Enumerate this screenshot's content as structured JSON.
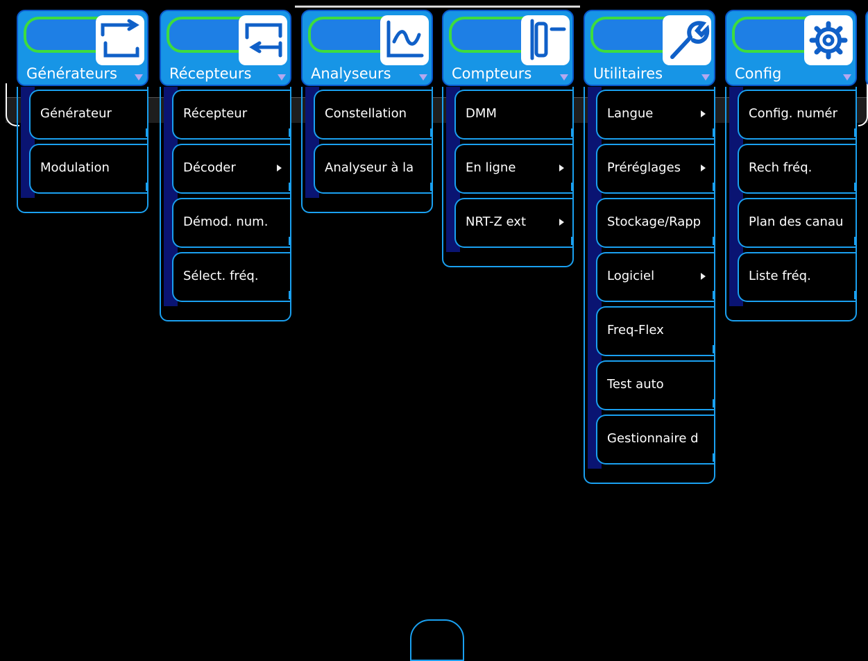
{
  "menus": [
    {
      "label": "Générateurs",
      "icon": "generator-icon",
      "items": [
        {
          "label": "Générateur",
          "submenu": false
        },
        {
          "label": "Modulation",
          "submenu": false
        }
      ]
    },
    {
      "label": "Récepteurs",
      "icon": "receiver-icon",
      "items": [
        {
          "label": "Récepteur",
          "submenu": false
        },
        {
          "label": "Décoder",
          "submenu": true
        },
        {
          "label": "Démod. num.",
          "submenu": false
        },
        {
          "label": "Sélect. fréq.",
          "submenu": false
        }
      ]
    },
    {
      "label": "Analyseurs",
      "icon": "analyzer-icon",
      "items": [
        {
          "label": "Constellation",
          "submenu": false
        },
        {
          "label": "Analyseur à la",
          "submenu": false
        }
      ]
    },
    {
      "label": "Compteurs",
      "icon": "meter-icon",
      "items": [
        {
          "label": "DMM",
          "submenu": false
        },
        {
          "label": "En ligne",
          "submenu": true
        },
        {
          "label": "NRT-Z ext",
          "submenu": true
        }
      ]
    },
    {
      "label": "Utilitaires",
      "icon": "wrench-icon",
      "items": [
        {
          "label": "Langue",
          "submenu": true
        },
        {
          "label": "Préréglages",
          "submenu": true
        },
        {
          "label": "Stockage/Rapp",
          "submenu": false
        },
        {
          "label": "Logiciel",
          "submenu": true
        },
        {
          "label": "Freq-Flex",
          "submenu": false
        },
        {
          "label": "Test auto",
          "submenu": false
        },
        {
          "label": "Gestionnaire d",
          "submenu": false
        }
      ]
    },
    {
      "label": "Config",
      "icon": "gear-icon",
      "items": [
        {
          "label": "Config. numér",
          "submenu": false
        },
        {
          "label": "Rech fréq.",
          "submenu": false
        },
        {
          "label": "Plan des canau",
          "submenu": false
        },
        {
          "label": "Liste fréq.",
          "submenu": false
        }
      ]
    }
  ],
  "colors": {
    "tab_bg": "#1795e6",
    "tab_border": "#0a56c8",
    "tab_highlight": "#3edc3e",
    "item_border": "#1aa0f0",
    "strip": "#0a1472",
    "background": "#000000"
  }
}
